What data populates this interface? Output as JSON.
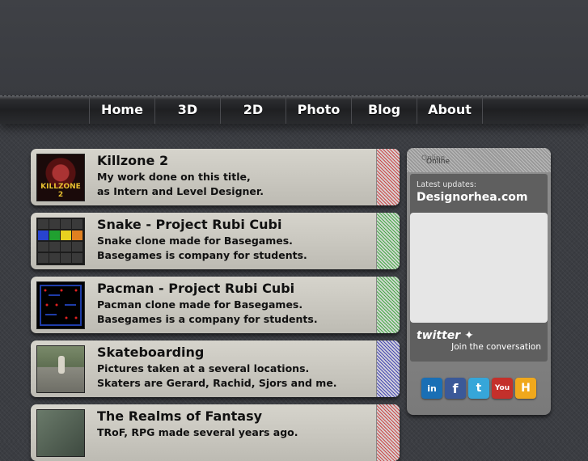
{
  "nav": {
    "items": [
      {
        "label": "Home"
      },
      {
        "label": "3D"
      },
      {
        "label": "2D"
      },
      {
        "label": "Photo"
      },
      {
        "label": "Blog"
      },
      {
        "label": "About"
      }
    ]
  },
  "projects": [
    {
      "title": "Killzone 2",
      "line1": "My work done on this title,",
      "line2": "as Intern and Level Designer.",
      "thumb_text": "KILLZONE 2",
      "accent": "#c94a4a"
    },
    {
      "title": "Snake - Project Rubi Cubi",
      "line1": "Snake clone made for Basegames.",
      "line2": "Basegames is company for students.",
      "accent": "#4aa84a"
    },
    {
      "title": "Pacman - Project Rubi Cubi",
      "line1": "Pacman clone made for Basegames.",
      "line2": "Basegames is a company for students.",
      "accent": "#4aa84a"
    },
    {
      "title": "Skateboarding",
      "line1": "Pictures taken at a several locations.",
      "line2": "Skaters are Gerard, Rachid, Sjors and me.",
      "accent": "#4a4ab0"
    },
    {
      "title": "The Realms of Fantasy",
      "line1": "TRoF, RPG made several years ago.",
      "line2": "",
      "accent": "#c94a4a"
    }
  ],
  "sidebar": {
    "status": "Online",
    "latest_label": "Latest updates:",
    "site": "Designorhea.com",
    "twitter_logo": "twitter",
    "join": "Join the conversation",
    "social": [
      {
        "name": "linkedin-icon",
        "label": "in",
        "color": "#1a6fb5"
      },
      {
        "name": "facebook-icon",
        "label": "f",
        "color": "#3b5998"
      },
      {
        "name": "twitter-icon",
        "label": "t",
        "color": "#36a6d9"
      },
      {
        "name": "youtube-icon",
        "label": "You",
        "color": "#c4302b"
      },
      {
        "name": "hyves-icon",
        "label": "H",
        "color": "#f0a81c"
      }
    ]
  }
}
